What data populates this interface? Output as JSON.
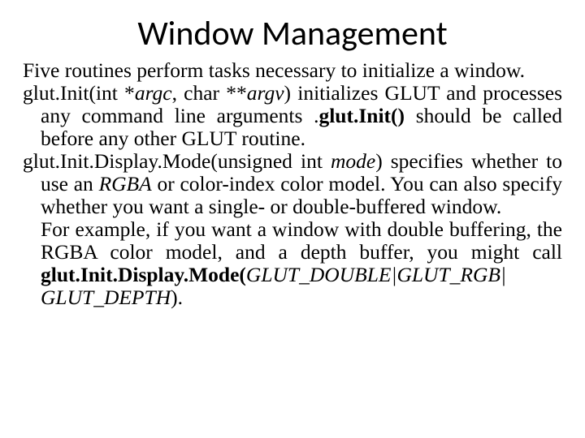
{
  "title": "Window Management",
  "p1": "Five routines perform tasks necessary to initialize a window.",
  "p2_a": "glut.Init(int *",
  "p2_b": "argc",
  "p2_c": ", char **",
  "p2_d": "argv",
  "p2_e": ") initializes GLUT and processes any command line arguments .",
  "p2_f": "glut.Init()",
  "p2_g": " should be called before any other GLUT routine.",
  "p3_a": "glut.Init.Display.Mode(unsigned int ",
  "p3_b": "mode",
  "p3_c": ") specifies whether to use an ",
  "p3_d": "RGBA",
  "p3_e": " or color-index color model. You can also specify whether you want a single- or double-buffered window.",
  "p4_a": "For example, if you want a window with double buffering, the RGBA color model, and a depth buffer, you might call ",
  "p4_b": "glut.Init.Display.Mode(",
  "p4_c": "GLUT_DOUBLE|GLUT_RGB| GLUT_DEPTH",
  "p4_d": ")."
}
